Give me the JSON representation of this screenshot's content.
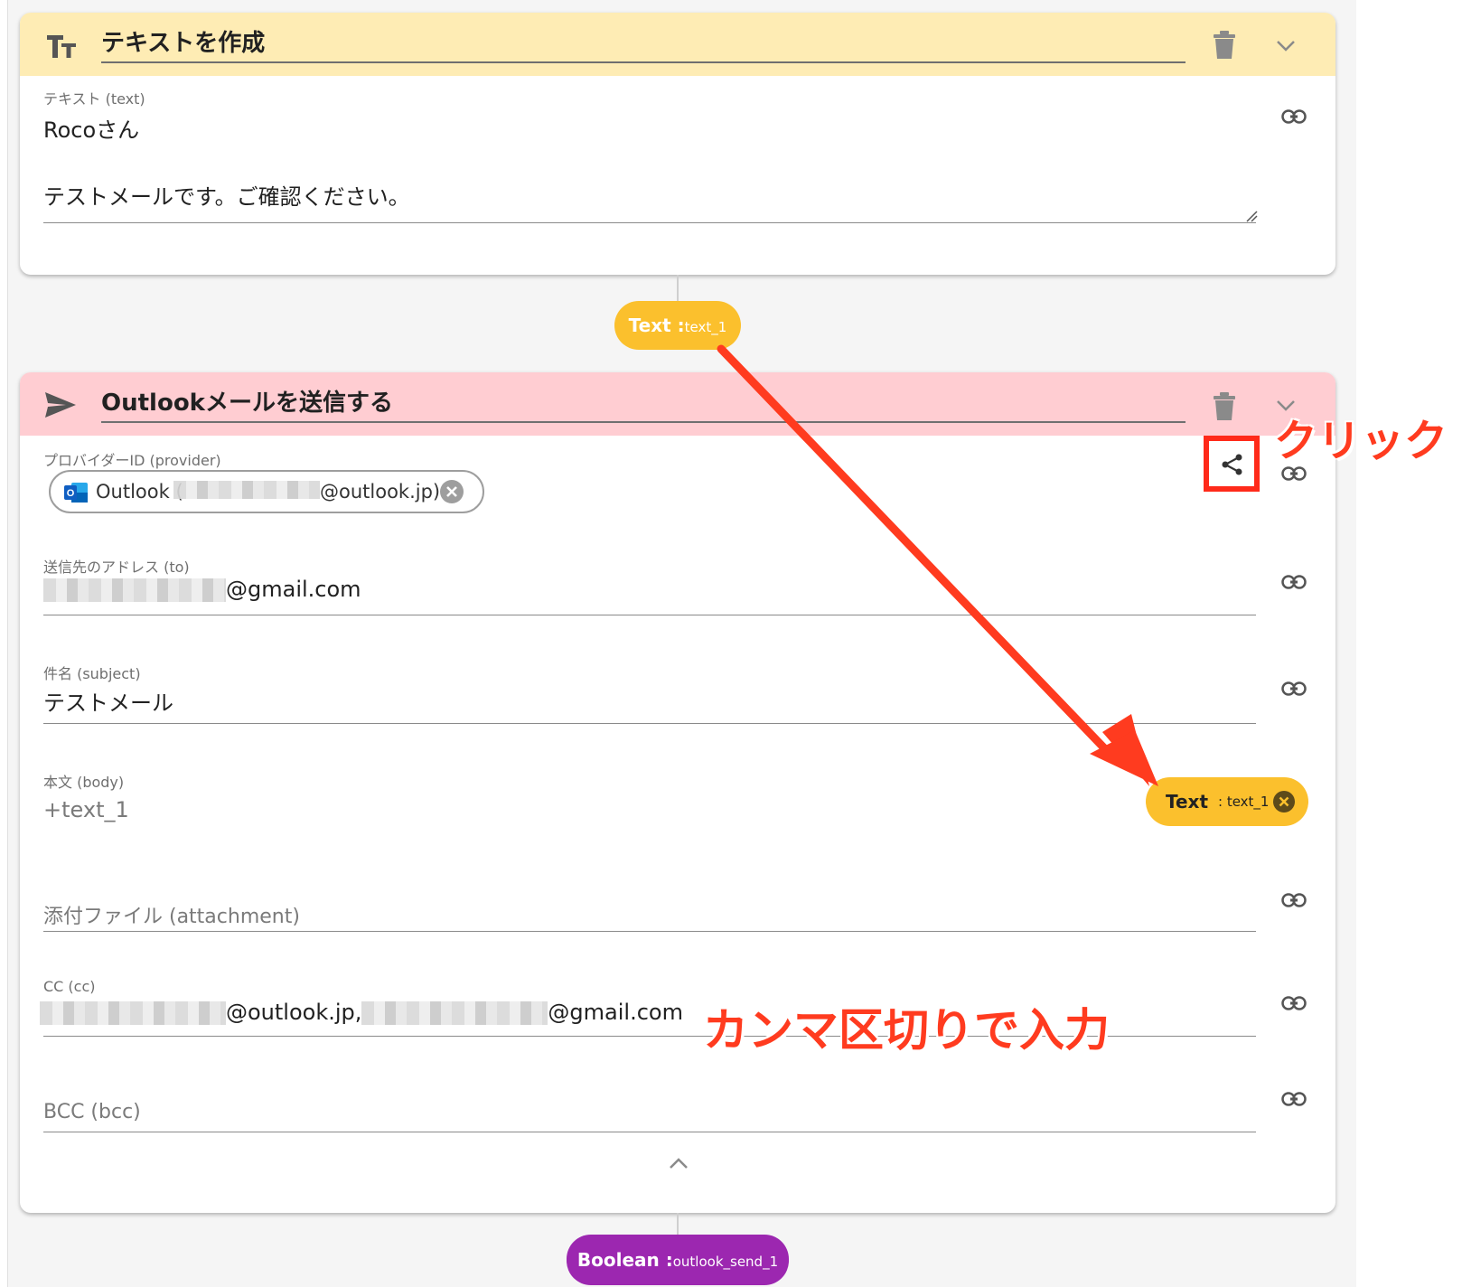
{
  "card1": {
    "title": "テキストを作成",
    "text_label": "テキスト (text)",
    "text_line1": "Rocoさん",
    "text_line2": "テストメールです。ご確認ください。"
  },
  "output1": {
    "type": "Text",
    "name": "text_1"
  },
  "card2": {
    "title": "Outlookメールを送信する",
    "provider_label": "プロバイダーID (provider)",
    "provider_prefix": "Outlook (",
    "provider_suffix": "@outlook.jp)",
    "to_label": "送信先のアドレス (to)",
    "to_suffix": "@gmail.com",
    "subject_label": "件名 (subject)",
    "subject_value": "テストメール",
    "body_label": "本文 (body)",
    "body_value": "+text_1",
    "body_chip_type": "Text",
    "body_chip_name": ": text_1",
    "attachment_placeholder": "添付ファイル (attachment)",
    "cc_label": "CC (cc)",
    "cc_part1": "@outlook.jp,",
    "cc_part2": "@gmail.com",
    "bcc_placeholder": "BCC (bcc)"
  },
  "output2": {
    "type": "Boolean",
    "name": "outlook_send_1"
  },
  "annotations": {
    "click": "クリック",
    "comma": "カンマ区切りで入力"
  },
  "colors": {
    "card1_header": "#feecb4",
    "card2_header": "#ffcdd2",
    "text_pill": "#fbc02d",
    "boolean_pill": "#9c27b0",
    "annotation_red": "#ff3b1f"
  },
  "icons": [
    "text-format-icon",
    "send-icon",
    "delete-icon",
    "chevron-down-icon",
    "link-icon",
    "share-icon",
    "outlook-icon",
    "close-circle-icon",
    "chevron-up-icon"
  ]
}
